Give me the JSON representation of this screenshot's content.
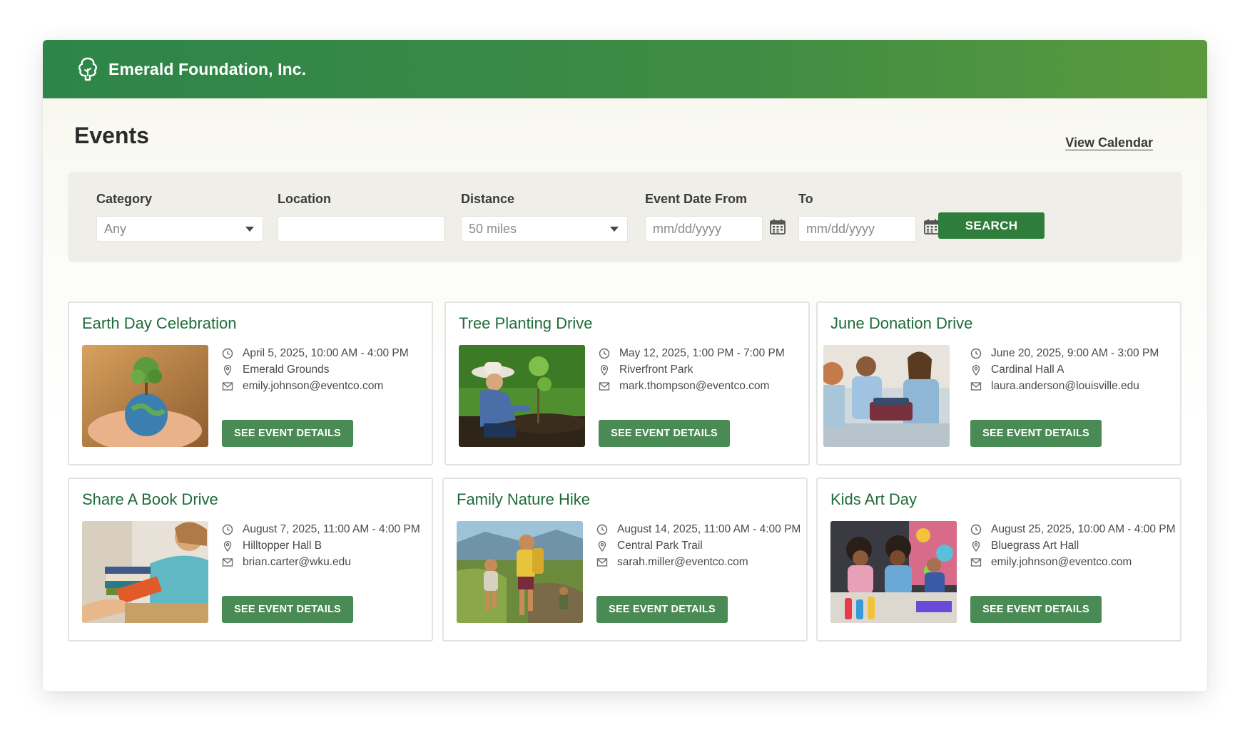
{
  "header": {
    "org_name": "Emerald Foundation, Inc.",
    "logo_icon": "tree-icon",
    "brand_color": "#2d8549"
  },
  "page": {
    "title": "Events",
    "view_calendar_label": "View Calendar"
  },
  "filters": {
    "category": {
      "label": "Category",
      "value": "Any"
    },
    "location": {
      "label": "Location",
      "value": "",
      "placeholder": ""
    },
    "distance": {
      "label": "Distance",
      "value": "50 miles"
    },
    "date_from": {
      "label": "Event Date From",
      "placeholder": "mm/dd/yyyy"
    },
    "date_to": {
      "label": "To",
      "placeholder": "mm/dd/yyyy"
    },
    "search_label": "SEARCH"
  },
  "events": [
    {
      "title": "Earth Day Celebration",
      "datetime": "April 5, 2025, 10:00 AM - 4:00 PM",
      "location": "Emerald Grounds",
      "email": "emily.johnson@eventco.com",
      "button": "SEE EVENT DETAILS",
      "image": "hands-holding-globe-tree"
    },
    {
      "title": "Tree Planting Drive",
      "datetime": "May 12, 2025, 1:00 PM - 7:00 PM",
      "location": "Riverfront Park",
      "email": "mark.thompson@eventco.com",
      "button": "SEE EVENT DETAILS",
      "image": "person-planting-tree"
    },
    {
      "title": "June Donation Drive",
      "datetime": "June 20, 2025, 9:00 AM - 3:00 PM",
      "location": "Cardinal Hall A",
      "email": "laura.anderson@louisville.edu",
      "button": "SEE EVENT DETAILS",
      "image": "volunteers-sorting-clothes"
    },
    {
      "title": "Share A Book Drive",
      "datetime": "August 7, 2025, 11:00 AM - 4:00 PM",
      "location": "Hilltopper Hall B",
      "email": "brian.carter@wku.edu",
      "button": "SEE EVENT DETAILS",
      "image": "handing-books"
    },
    {
      "title": "Family Nature Hike",
      "datetime": "August 14, 2025, 11:00 AM - 4:00 PM",
      "location": "Central Park Trail",
      "email": "sarah.miller@eventco.com",
      "button": "SEE EVENT DETAILS",
      "image": "family-hiking-trail"
    },
    {
      "title": "Kids Art Day",
      "datetime": "August 25, 2025, 10:00 AM - 4:00 PM",
      "location": "Bluegrass Art Hall",
      "email": "emily.johnson@eventco.com",
      "button": "SEE EVENT DETAILS",
      "image": "kids-painting"
    }
  ],
  "colors": {
    "title_green": "#1f6b3a",
    "button_green": "#4a8a54",
    "search_green": "#2f7d3b"
  }
}
